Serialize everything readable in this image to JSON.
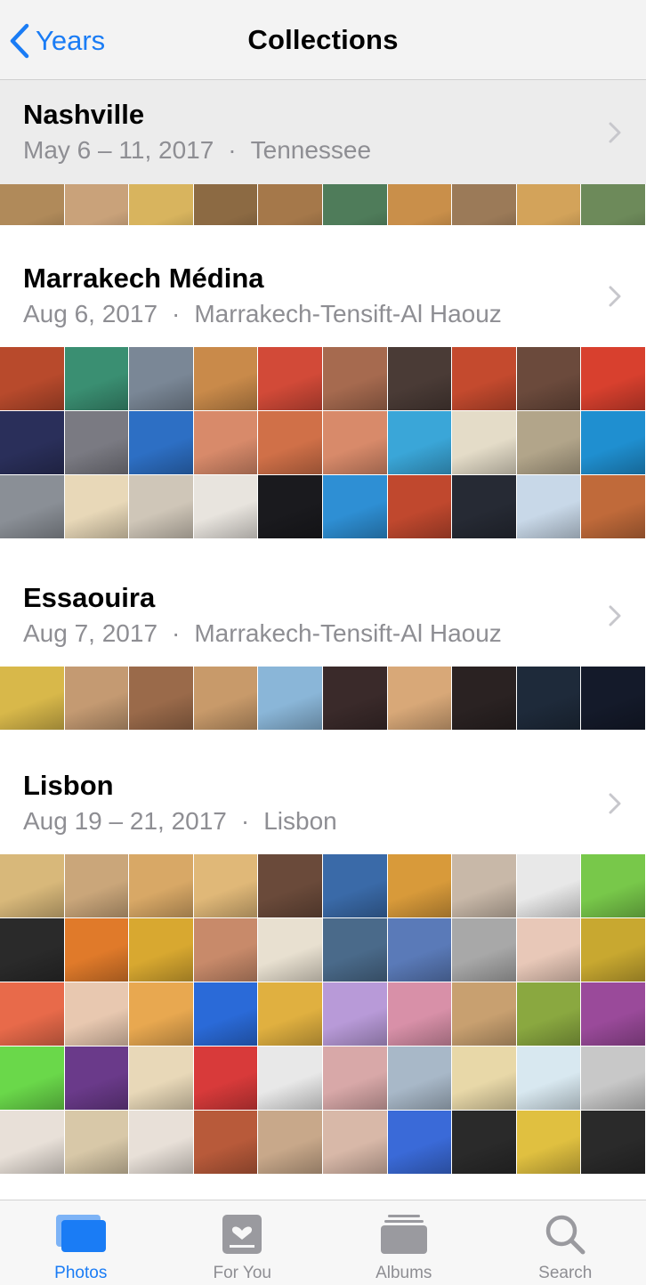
{
  "nav": {
    "back_label": "Years",
    "title": "Collections"
  },
  "collections": [
    {
      "title": "Nashville",
      "dates": "May 6 – 11, 2017",
      "separator": "·",
      "location": "Tennessee",
      "thumbs": [
        "#b08a5a",
        "#c9a27a",
        "#d8b45e",
        "#8c6a43",
        "#a5784a",
        "#4f7c5a",
        "#c98f4a",
        "#9b7a58",
        "#d3a35a",
        "#6d8a5a"
      ]
    },
    {
      "title": "Marrakech Médina",
      "dates": "Aug 6, 2017",
      "separator": "·",
      "location": "Marrakech-Tensift-Al Haouz",
      "thumbs": [
        "#b84a2c",
        "#3a8f72",
        "#7a8796",
        "#c98a4a",
        "#d24a38",
        "#a66a4f",
        "#4a3b36",
        "#c44a2e",
        "#6b4a3c",
        "#d8402e",
        "#2a2f5a",
        "#7a7a82",
        "#2d6fc4",
        "#d88a6a",
        "#d07048",
        "#d88a6a",
        "#3aa6d8",
        "#e4dcc8",
        "#b2a58a",
        "#1f8fd0",
        "#8a8f96",
        "#e8d8b8",
        "#cfc6b8",
        "#e8e4de",
        "#1a1a1e",
        "#2e8fd4",
        "#c0482e",
        "#262a34",
        "#c8d8e8",
        "#c06a3a"
      ]
    },
    {
      "title": "Essaouira",
      "dates": "Aug 7, 2017",
      "separator": "·",
      "location": "Marrakech-Tensift-Al Haouz",
      "thumbs": [
        "#d8b84a",
        "#c49a72",
        "#9a6a4a",
        "#c89a6a",
        "#8ab6d8",
        "#3a2a2a",
        "#d8a878",
        "#2a2222",
        "#1e2a3a",
        "#141a2a"
      ]
    },
    {
      "title": "Lisbon",
      "dates": "Aug 19 – 21, 2017",
      "separator": "·",
      "location": "Lisbon",
      "thumbs": [
        "#d8b87a",
        "#caa67a",
        "#d8a866",
        "#e0b878",
        "#6a4a3a",
        "#3a6aa8",
        "#d89a3a",
        "#c8b8a8",
        "#e8e8e8",
        "#78c84a",
        "#2a2a2a",
        "#e07a2a",
        "#d8a830",
        "#c88a6a",
        "#e8e0d0",
        "#4a6a8a",
        "#5a7ab8",
        "#a8a8a8",
        "#e8c8b8",
        "#c8a830",
        "#e86a4a",
        "#e8c8b0",
        "#e8a850",
        "#2a6ad8",
        "#e0b040",
        "#b89ad8",
        "#d890a8",
        "#c8a070",
        "#8aa840",
        "#9a4a9a",
        "#6ad84a",
        "#6a3a8a",
        "#e8d8b8",
        "#d83a3a",
        "#e8e8e8",
        "#d8a8a8",
        "#a8b8c8",
        "#e8d8a8",
        "#d8e8f0",
        "#c8c8c8",
        "#e8e0d8",
        "#d8c8a8",
        "#e8e0d8",
        "#b85a3a",
        "#c8a88a",
        "#d8b8a8",
        "#3a6ad8",
        "#2a2a2a",
        "#e0c040",
        "#2a2a2a"
      ]
    }
  ],
  "tabs": [
    {
      "label": "Photos",
      "icon": "photos-icon",
      "active": true
    },
    {
      "label": "For You",
      "icon": "for-you-icon",
      "active": false
    },
    {
      "label": "Albums",
      "icon": "albums-icon",
      "active": false
    },
    {
      "label": "Search",
      "icon": "search-icon",
      "active": false
    }
  ],
  "colors": {
    "accent": "#1a7cf5",
    "secondary_text": "#8e8e93"
  }
}
